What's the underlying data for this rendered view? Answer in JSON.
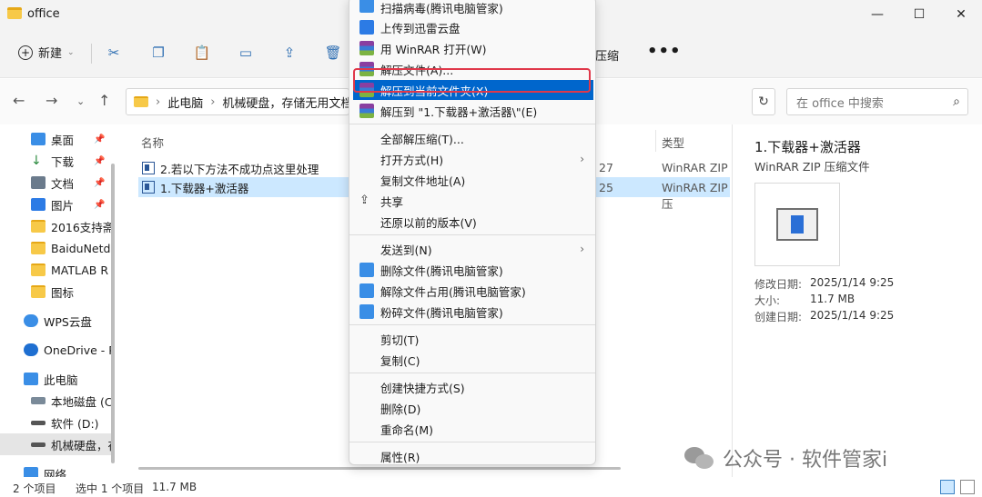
{
  "window": {
    "title": "office"
  },
  "toolbar": {
    "new_label": "新建",
    "compress_label": "压缩",
    "more_label": "•••"
  },
  "address": {
    "path_part1": "此电脑",
    "path_part2": "机械硬盘，存储无用文档",
    "search_placeholder": "在 office 中搜索"
  },
  "sidebar": {
    "items": [
      {
        "label": "桌面"
      },
      {
        "label": "下载"
      },
      {
        "label": "文档"
      },
      {
        "label": "图片"
      },
      {
        "label": "2016支持斋"
      },
      {
        "label": "BaiduNetd"
      },
      {
        "label": "MATLAB R"
      },
      {
        "label": "图标"
      },
      {
        "label": "WPS云盘"
      },
      {
        "label": "OneDrive - P"
      },
      {
        "label": "此电脑"
      },
      {
        "label": "本地磁盘 (C"
      },
      {
        "label": "软件 (D:)"
      },
      {
        "label": "机械硬盘，存"
      },
      {
        "label": "网络"
      }
    ]
  },
  "filelist": {
    "headers": {
      "name": "名称",
      "type": "类型"
    },
    "rows": [
      {
        "name": "2.若以下方法不成功点这里处理",
        "date": "27",
        "type": "WinRAR ZIP 压"
      },
      {
        "name": "1.下载器+激活器",
        "date": "25",
        "type": "WinRAR ZIP 压"
      }
    ]
  },
  "context_menu": {
    "items": [
      {
        "label": "扫描病毒(腾讯电脑管家)"
      },
      {
        "label": "上传到迅雷云盘"
      },
      {
        "label": "用 WinRAR 打开(W)"
      },
      {
        "label": "解压文件(A)..."
      },
      {
        "label": "解压到当前文件夹(X)"
      },
      {
        "label": "解压到 \"1.下载器+激活器\\\"(E)"
      },
      {
        "label": "全部解压缩(T)..."
      },
      {
        "label": "打开方式(H)"
      },
      {
        "label": "复制文件地址(A)"
      },
      {
        "label": "共享"
      },
      {
        "label": "还原以前的版本(V)"
      },
      {
        "label": "发送到(N)"
      },
      {
        "label": "删除文件(腾讯电脑管家)"
      },
      {
        "label": "解除文件占用(腾讯电脑管家)"
      },
      {
        "label": "粉碎文件(腾讯电脑管家)"
      },
      {
        "label": "剪切(T)"
      },
      {
        "label": "复制(C)"
      },
      {
        "label": "创建快捷方式(S)"
      },
      {
        "label": "删除(D)"
      },
      {
        "label": "重命名(M)"
      },
      {
        "label": "属性(R)"
      }
    ]
  },
  "details": {
    "title": "1.下载器+激活器",
    "subtitle": "WinRAR ZIP 压缩文件",
    "modified_label": "修改日期:",
    "modified_value": "2025/1/14 9:25",
    "size_label": "大小:",
    "size_value": "11.7 MB",
    "created_label": "创建日期:",
    "created_value": "2025/1/14 9:25"
  },
  "status": {
    "count": "2 个项目",
    "selected": "选中 1 个项目",
    "size": "11.7 MB"
  },
  "watermark": {
    "text": "公众号 · 软件管家i"
  },
  "colors": {
    "highlight": "#0066cc",
    "annotation_box": "#e0384a",
    "selected_row": "#cce8ff"
  }
}
